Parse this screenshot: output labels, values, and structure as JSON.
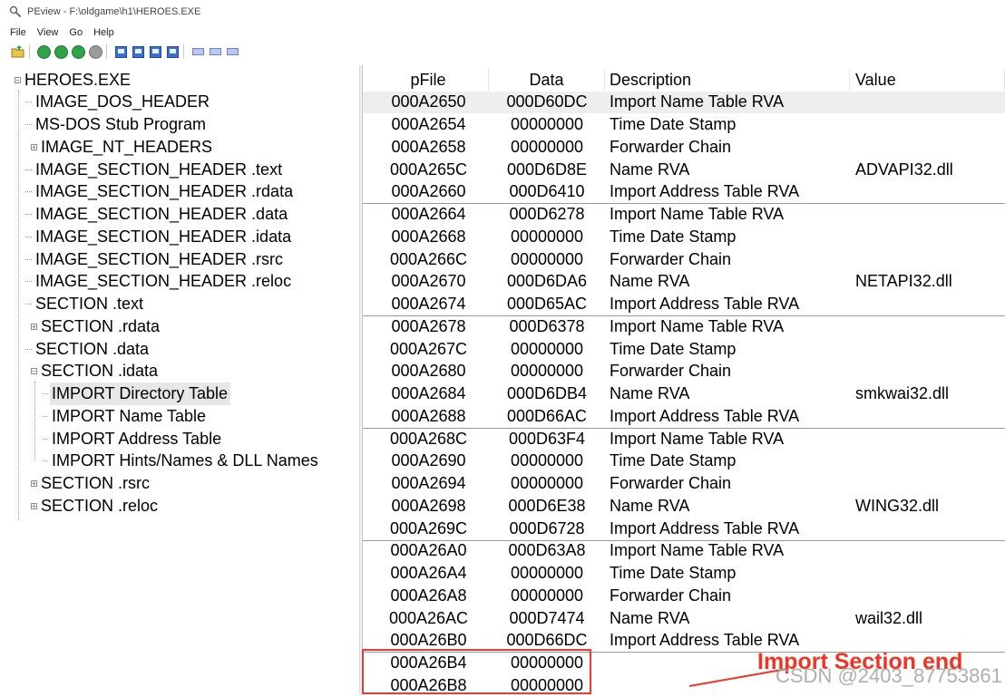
{
  "window": {
    "title": "PEview - F:\\oldgame\\h1\\HEROES.EXE"
  },
  "menu": [
    "File",
    "View",
    "Go",
    "Help"
  ],
  "tree": [
    {
      "label": "HEROES.EXE",
      "expander": "minus"
    },
    {
      "label": "IMAGE_DOS_HEADER"
    },
    {
      "label": "MS-DOS Stub Program"
    },
    {
      "label": "IMAGE_NT_HEADERS",
      "expander": "plus"
    },
    {
      "label": "IMAGE_SECTION_HEADER .text"
    },
    {
      "label": "IMAGE_SECTION_HEADER .rdata"
    },
    {
      "label": "IMAGE_SECTION_HEADER .data"
    },
    {
      "label": "IMAGE_SECTION_HEADER .idata"
    },
    {
      "label": "IMAGE_SECTION_HEADER .rsrc"
    },
    {
      "label": "IMAGE_SECTION_HEADER .reloc"
    },
    {
      "label": "SECTION .text"
    },
    {
      "label": "SECTION .rdata",
      "expander": "plus"
    },
    {
      "label": "SECTION .data"
    },
    {
      "label": "SECTION .idata",
      "expander": "minus"
    },
    {
      "label": "IMPORT Directory Table",
      "selected": true
    },
    {
      "label": "IMPORT Name Table"
    },
    {
      "label": "IMPORT Address Table"
    },
    {
      "label": "IMPORT Hints/Names & DLL Names"
    },
    {
      "label": "SECTION .rsrc",
      "expander": "plus"
    },
    {
      "label": "SECTION .reloc",
      "expander": "plus"
    }
  ],
  "columns": {
    "pfile": "pFile",
    "data": "Data",
    "desc": "Description",
    "value": "Value"
  },
  "rows": [
    {
      "pfile": "000A2650",
      "data": "000D60DC",
      "desc": "Import Name Table RVA",
      "value": ""
    },
    {
      "pfile": "000A2654",
      "data": "00000000",
      "desc": "Time Date Stamp",
      "value": ""
    },
    {
      "pfile": "000A2658",
      "data": "00000000",
      "desc": "Forwarder Chain",
      "value": ""
    },
    {
      "pfile": "000A265C",
      "data": "000D6D8E",
      "desc": "Name RVA",
      "value": "ADVAPI32.dll"
    },
    {
      "pfile": "000A2660",
      "data": "000D6410",
      "desc": "Import Address Table RVA",
      "value": ""
    },
    {
      "pfile": "000A2664",
      "data": "000D6278",
      "desc": "Import Name Table RVA",
      "value": ""
    },
    {
      "pfile": "000A2668",
      "data": "00000000",
      "desc": "Time Date Stamp",
      "value": ""
    },
    {
      "pfile": "000A266C",
      "data": "00000000",
      "desc": "Forwarder Chain",
      "value": ""
    },
    {
      "pfile": "000A2670",
      "data": "000D6DA6",
      "desc": "Name RVA",
      "value": "NETAPI32.dll"
    },
    {
      "pfile": "000A2674",
      "data": "000D65AC",
      "desc": "Import Address Table RVA",
      "value": ""
    },
    {
      "pfile": "000A2678",
      "data": "000D6378",
      "desc": "Import Name Table RVA",
      "value": ""
    },
    {
      "pfile": "000A267C",
      "data": "00000000",
      "desc": "Time Date Stamp",
      "value": ""
    },
    {
      "pfile": "000A2680",
      "data": "00000000",
      "desc": "Forwarder Chain",
      "value": ""
    },
    {
      "pfile": "000A2684",
      "data": "000D6DB4",
      "desc": "Name RVA",
      "value": "smkwai32.dll"
    },
    {
      "pfile": "000A2688",
      "data": "000D66AC",
      "desc": "Import Address Table RVA",
      "value": ""
    },
    {
      "pfile": "000A268C",
      "data": "000D63F4",
      "desc": "Import Name Table RVA",
      "value": ""
    },
    {
      "pfile": "000A2690",
      "data": "00000000",
      "desc": "Time Date Stamp",
      "value": ""
    },
    {
      "pfile": "000A2694",
      "data": "00000000",
      "desc": "Forwarder Chain",
      "value": ""
    },
    {
      "pfile": "000A2698",
      "data": "000D6E38",
      "desc": "Name RVA",
      "value": "WING32.dll"
    },
    {
      "pfile": "000A269C",
      "data": "000D6728",
      "desc": "Import Address Table RVA",
      "value": ""
    },
    {
      "pfile": "000A26A0",
      "data": "000D63A8",
      "desc": "Import Name Table RVA",
      "value": ""
    },
    {
      "pfile": "000A26A4",
      "data": "00000000",
      "desc": "Time Date Stamp",
      "value": ""
    },
    {
      "pfile": "000A26A8",
      "data": "00000000",
      "desc": "Forwarder Chain",
      "value": ""
    },
    {
      "pfile": "000A26AC",
      "data": "000D7474",
      "desc": "Name RVA",
      "value": "wail32.dll"
    },
    {
      "pfile": "000A26B0",
      "data": "000D66DC",
      "desc": "Import Address Table RVA",
      "value": ""
    },
    {
      "pfile": "000A26B4",
      "data": "00000000",
      "desc": "",
      "value": ""
    },
    {
      "pfile": "000A26B8",
      "data": "00000000",
      "desc": "",
      "value": ""
    }
  ],
  "annotation": {
    "text": "Import Section end",
    "color": "#ee3525"
  },
  "watermark": "CSDN @2403_87753861",
  "icons": {
    "app": "magnifier-icon",
    "toolbar": [
      "open-icon",
      "back-icon",
      "forward-icon",
      "next-icon",
      "stop-icon",
      "view-1-icon",
      "view-2-icon",
      "view-3-icon",
      "view-4-icon",
      "byte-view-icon",
      "word-view-icon",
      "dword-view-icon"
    ]
  },
  "colors": {
    "selection": "#e7e7e7",
    "highlight_row": "#eeeeee",
    "toolbar_green": "#2fa24a",
    "toolbar_blue": "#3b6fd0"
  }
}
